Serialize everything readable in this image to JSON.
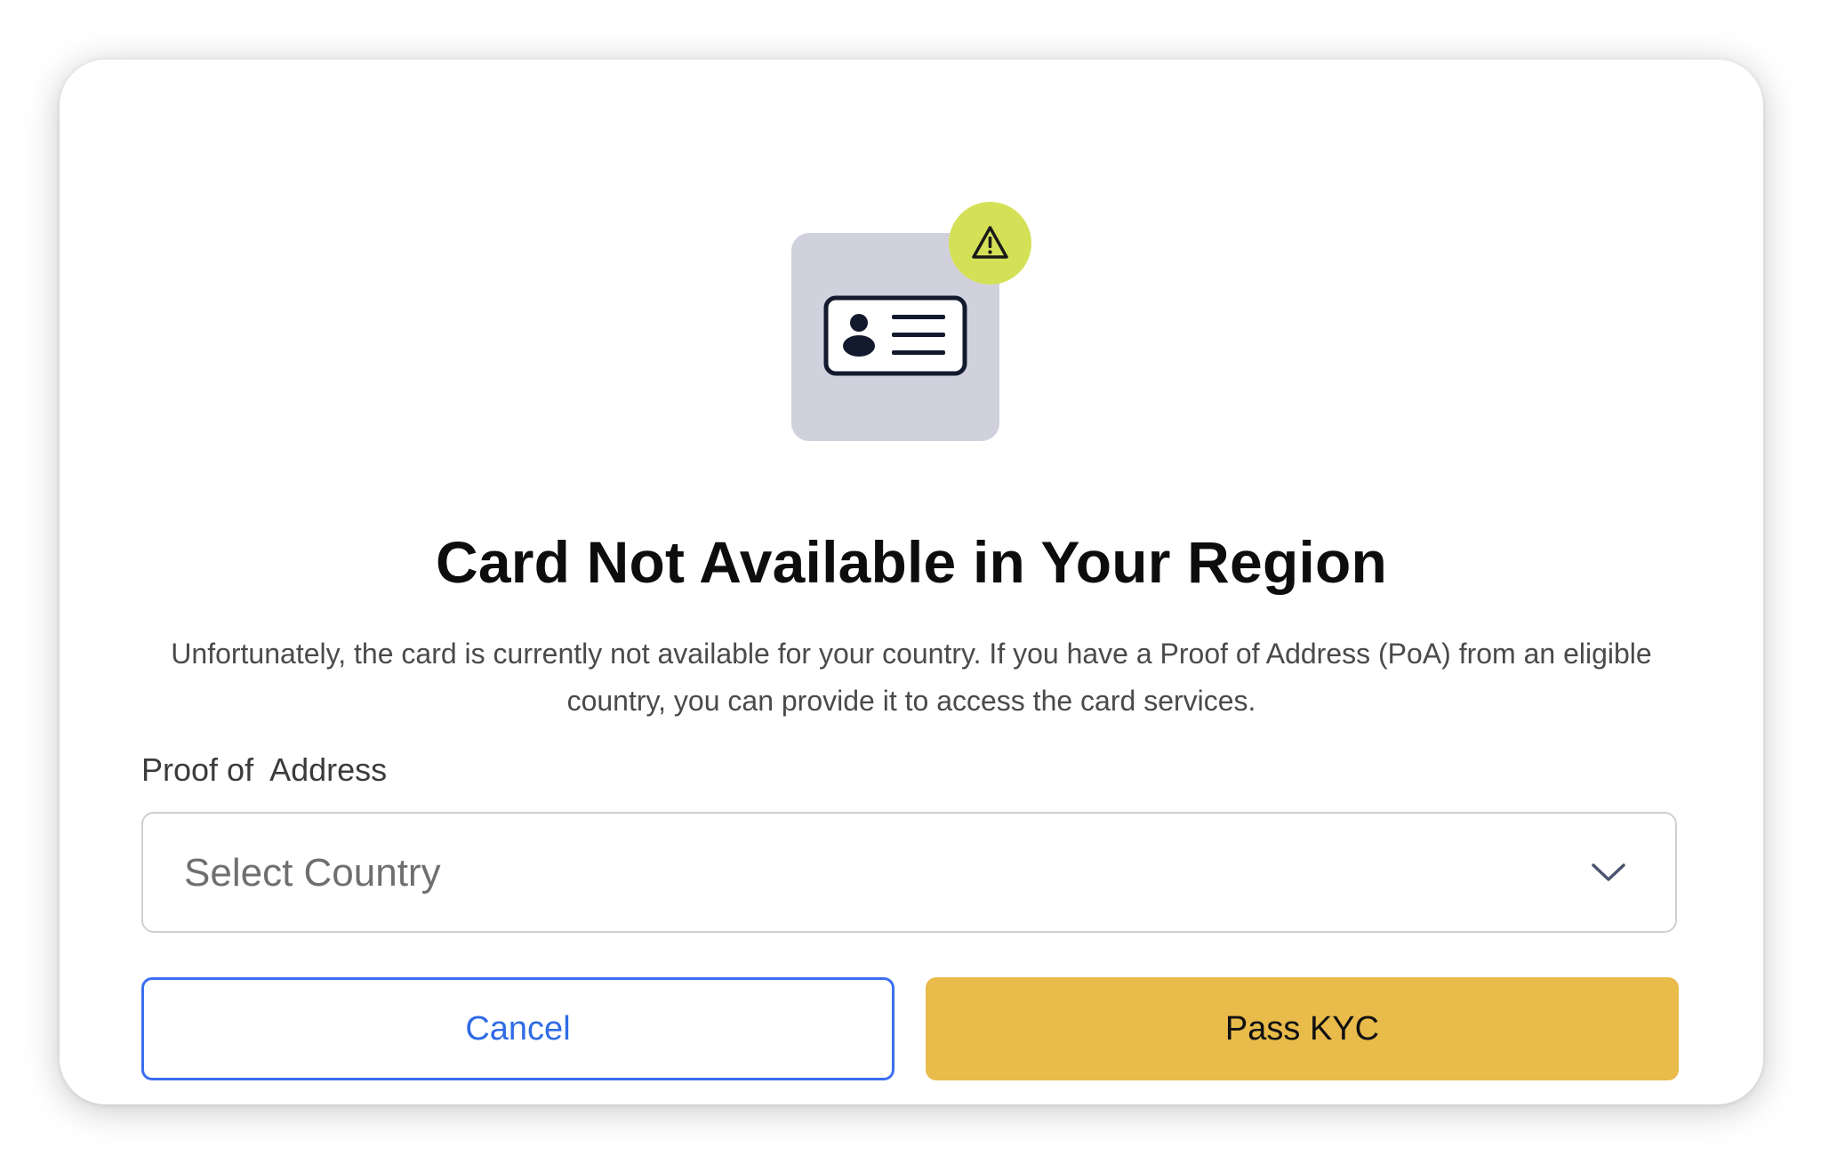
{
  "dialog": {
    "title": "Card Not Available in Your Region",
    "description": "Unfortunately, the card is currently not available for your country. If you have a Proof of Address (PoA) from an eligible country, you can provide it to access the card services.",
    "illustration": {
      "icon": "id-card-icon",
      "badge_icon": "warning-icon",
      "tile_color": "#d1d1de",
      "badge_color": "#d4e157"
    }
  },
  "form": {
    "label": "Proof of  Address",
    "select": {
      "placeholder": "Select Country",
      "icon": "chevron-down-icon"
    }
  },
  "actions": {
    "cancel_label": "Cancel",
    "primary_label": "Pass KYC",
    "cancel_color": "#2f6be6",
    "primary_color": "#e8bb4a"
  }
}
